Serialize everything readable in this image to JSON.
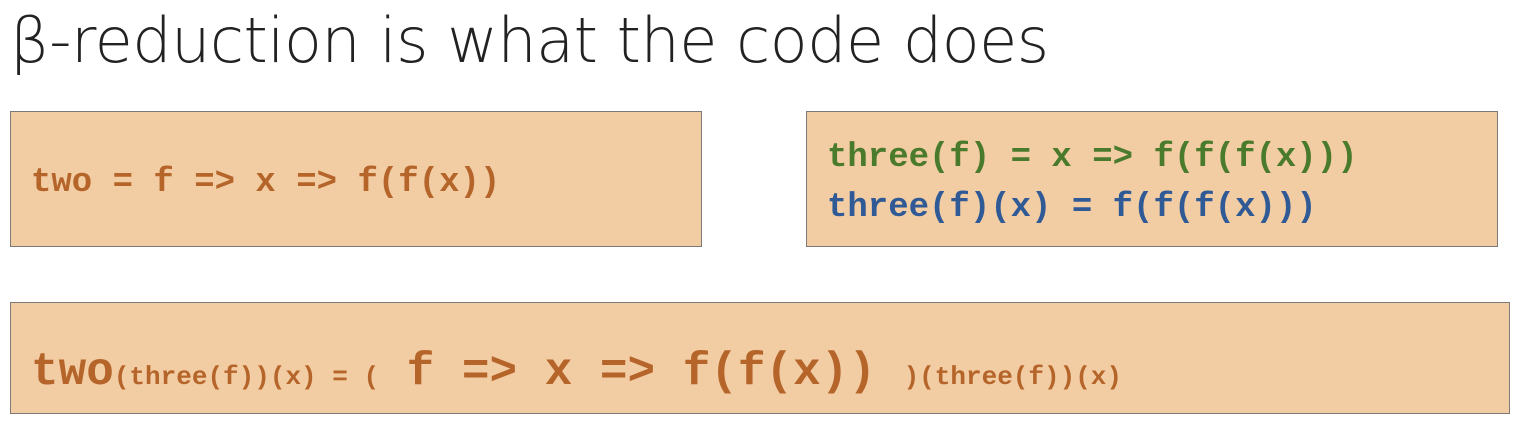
{
  "title": "β-reduction is what the code does",
  "colors": {
    "orange": "#b5652a",
    "green": "#4a7a2c",
    "blue": "#2f5a96",
    "box_fill": "#f2cca3"
  },
  "box_two": {
    "code": "two = f => x => f(f(x))"
  },
  "box_three": {
    "line1": "three(f) = x => f(f(f(x)))",
    "line2": "three(f)(x) = f(f(f(x)))"
  },
  "box_application": {
    "head": "two",
    "args_left": "(three(f))(x) = (",
    "body": " f => x => f(f(x)) ",
    "args_right": ")(three(f))(x)"
  }
}
